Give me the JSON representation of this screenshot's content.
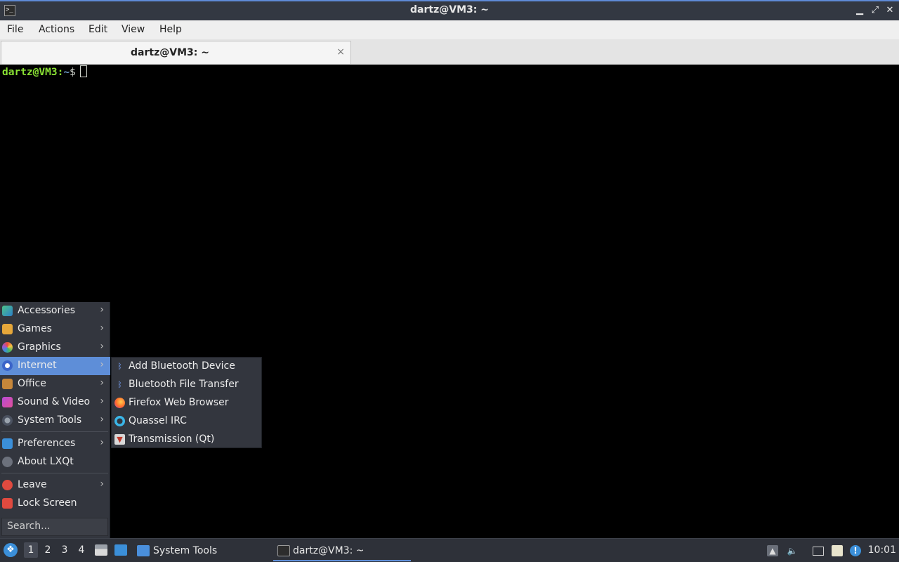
{
  "window": {
    "title": "dartz@VM3: ~",
    "app_icon": "terminal-icon",
    "controls": {
      "minimize": "▁",
      "maximize": "⤢",
      "close": "✕"
    }
  },
  "menubar": {
    "items": [
      "File",
      "Actions",
      "Edit",
      "View",
      "Help"
    ]
  },
  "tabs": [
    {
      "label": "dartz@VM3: ~",
      "close": "×"
    }
  ],
  "terminal": {
    "userhost": "dartz@VM3",
    "colon": ":",
    "path": "~",
    "dollar": "$",
    "colors": {
      "userhost": "#8ae234",
      "path": "#729fcf"
    }
  },
  "start_menu": {
    "items": [
      {
        "label": "Accessories",
        "icon": "accessories-icon",
        "submenu": true
      },
      {
        "label": "Games",
        "icon": "games-icon",
        "submenu": true
      },
      {
        "label": "Graphics",
        "icon": "graphics-icon",
        "submenu": true
      },
      {
        "label": "Internet",
        "icon": "internet-icon",
        "submenu": true,
        "active": true
      },
      {
        "label": "Office",
        "icon": "office-icon",
        "submenu": true
      },
      {
        "label": "Sound & Video",
        "icon": "sound-video-icon",
        "submenu": true
      },
      {
        "label": "System Tools",
        "icon": "system-tools-icon",
        "submenu": true
      },
      {
        "label": "Preferences",
        "icon": "preferences-icon",
        "submenu": true
      },
      {
        "label": "About LXQt",
        "icon": "info-icon",
        "submenu": false
      },
      {
        "label": "Leave",
        "icon": "power-icon",
        "submenu": true
      },
      {
        "label": "Lock Screen",
        "icon": "lock-icon",
        "submenu": false
      }
    ],
    "arrow": "›",
    "search": {
      "placeholder": "Search..."
    }
  },
  "internet_submenu": {
    "items": [
      {
        "label": "Add Bluetooth Device",
        "icon": "bluetooth-icon"
      },
      {
        "label": "Bluetooth File Transfer",
        "icon": "bluetooth-icon"
      },
      {
        "label": "Firefox Web Browser",
        "icon": "firefox-icon"
      },
      {
        "label": "Quassel IRC",
        "icon": "quassel-icon"
      },
      {
        "label": "Transmission (Qt)",
        "icon": "transmission-icon"
      }
    ]
  },
  "taskbar": {
    "desktops": [
      "1",
      "2",
      "3",
      "4"
    ],
    "active_desktop": "1",
    "tasks": [
      {
        "label": "System Tools",
        "icon": "folder-icon"
      },
      {
        "label": "dartz@VM3: ~",
        "icon": "terminal-icon",
        "active": true
      }
    ],
    "clock": "10:01",
    "accent": "#5e8ed8"
  }
}
